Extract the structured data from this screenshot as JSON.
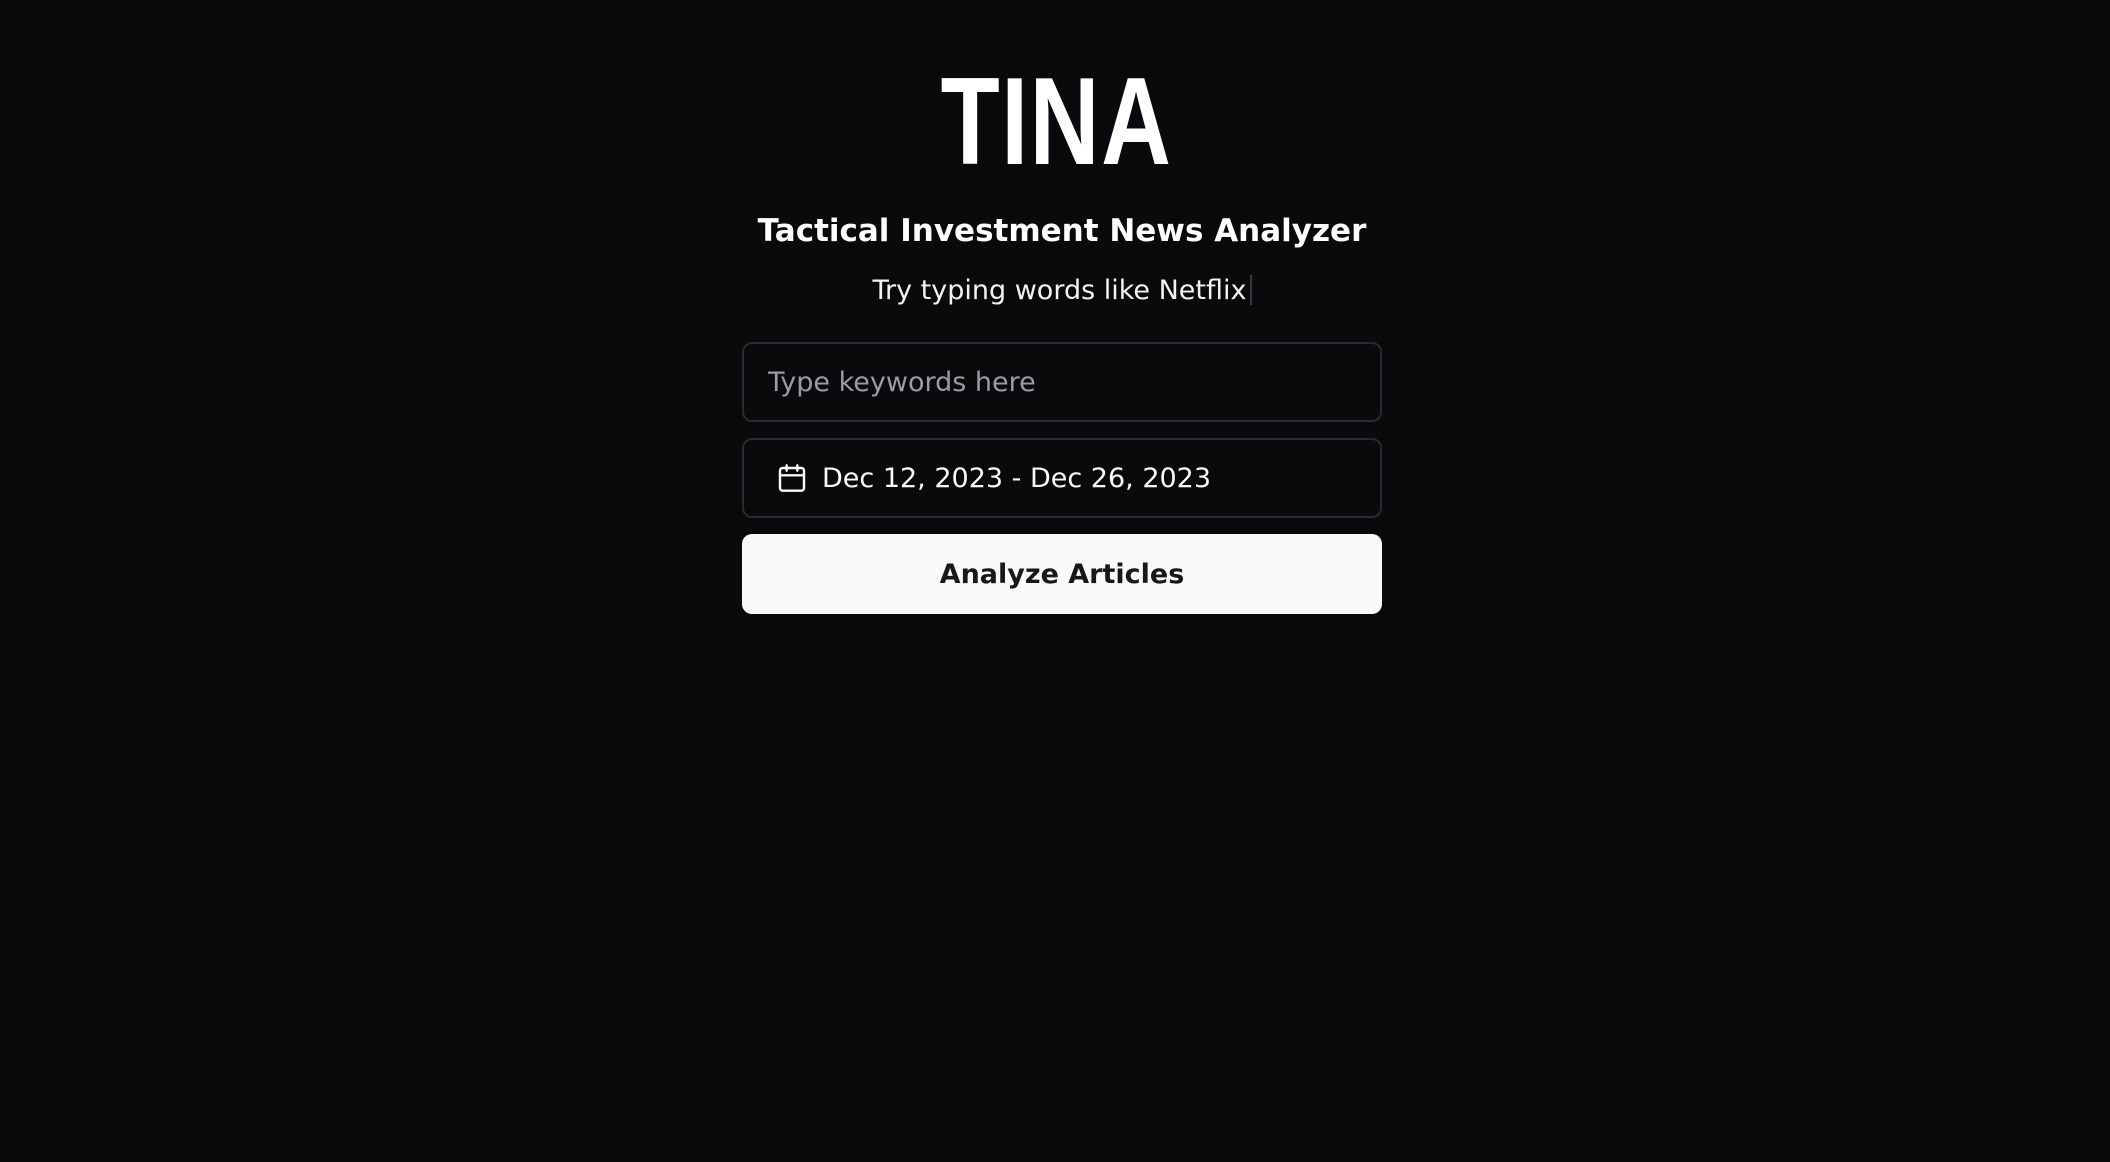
{
  "header": {
    "logo_text": "TINA",
    "subtitle": "Tactical Investment News Analyzer",
    "hint": "Try typing words like Netflix"
  },
  "form": {
    "keyword_input": {
      "placeholder": "Type keywords here",
      "value": ""
    },
    "date_range": {
      "icon": "calendar-icon",
      "label": "Dec 12, 2023 - Dec 26, 2023"
    },
    "submit_label": "Analyze Articles"
  },
  "colors": {
    "background": "#0a0a0c",
    "text": "#fafafa",
    "border": "#2a2a2e",
    "button_bg": "#fafafa",
    "button_text": "#18181b",
    "placeholder": "#9b9ba1"
  }
}
